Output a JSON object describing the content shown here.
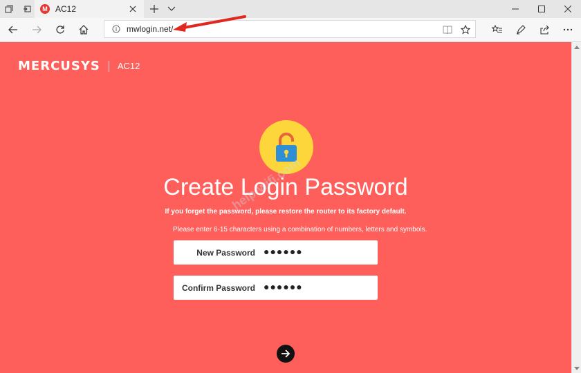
{
  "browser": {
    "tab_title": "AC12",
    "favicon_letter": "M",
    "url": "mwlogin.net/",
    "icons": [
      "tab-view-icon",
      "set-aside-tabs-icon",
      "close-icon",
      "plus-icon",
      "chevron-down-icon",
      "minimize-icon",
      "maximize-icon",
      "close-window-icon",
      "back-icon",
      "forward-icon",
      "refresh-icon",
      "home-icon",
      "info-icon",
      "reading-view-icon",
      "star-icon",
      "favorites-icon",
      "pen-icon",
      "share-icon",
      "more-icon"
    ]
  },
  "page": {
    "brand_name": "MERCUSYS",
    "model": "AC12",
    "headline": "Create Login Password",
    "warning": "If you forget the password, please restore the router to its factory default.",
    "hint": "Please enter 6-15 characters using a combination of numbers, letters and symbols.",
    "new_password_label": "New Password",
    "new_password_value": "●●●●●●",
    "confirm_password_label": "Confirm Password",
    "confirm_password_value": "●●●●●●",
    "watermark": "help-wifi.com"
  },
  "colors": {
    "page_bg": "#ff5f5a",
    "lock_circle": "#fcd63a",
    "lock_body": "#2f8fd6",
    "lock_shackle": "#e8623b",
    "arrow": "#e0281e"
  }
}
